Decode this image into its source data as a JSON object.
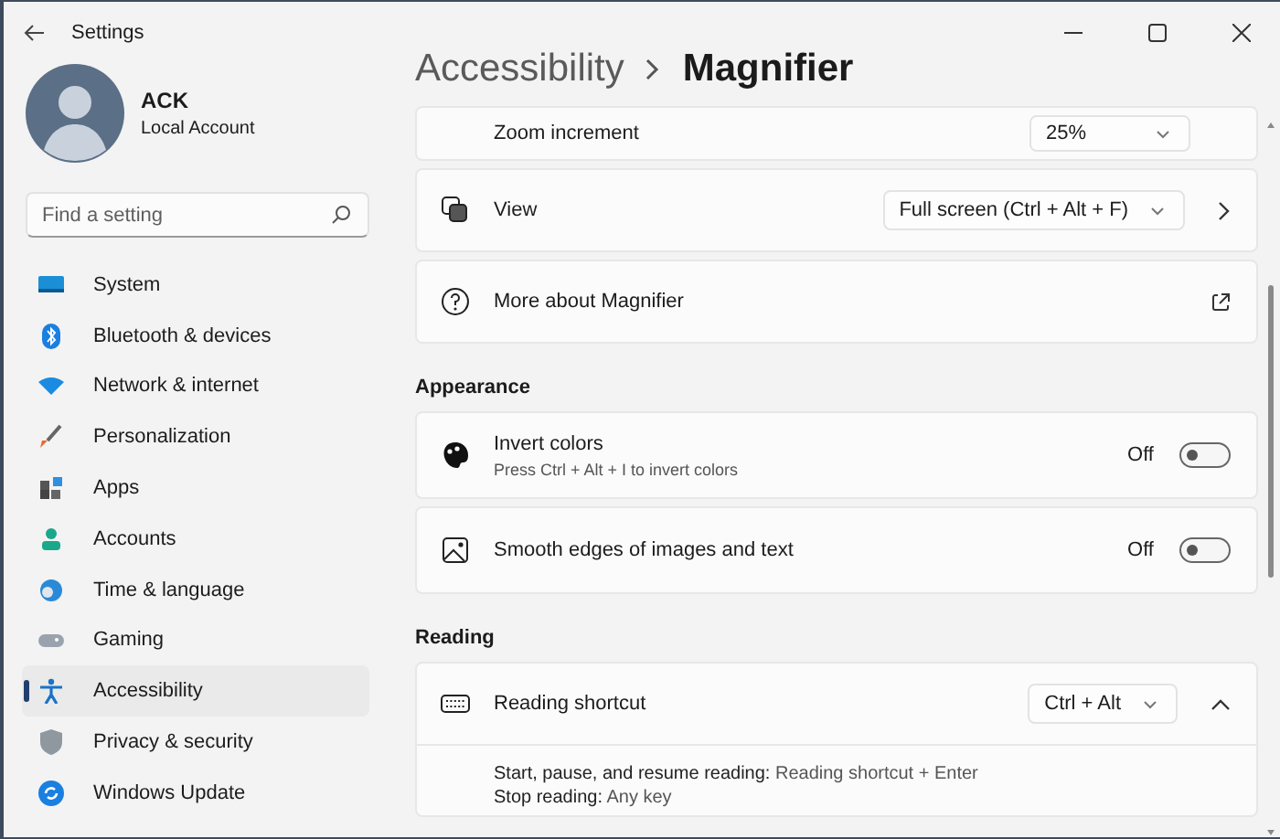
{
  "window": {
    "title": "Settings"
  },
  "account": {
    "name": "ACK",
    "type": "Local Account"
  },
  "search": {
    "placeholder": "Find a setting"
  },
  "nav": [
    {
      "label": "System",
      "selected": false
    },
    {
      "label": "Bluetooth & devices",
      "selected": false
    },
    {
      "label": "Network & internet",
      "selected": false
    },
    {
      "label": "Personalization",
      "selected": false
    },
    {
      "label": "Apps",
      "selected": false
    },
    {
      "label": "Accounts",
      "selected": false
    },
    {
      "label": "Time & language",
      "selected": false
    },
    {
      "label": "Gaming",
      "selected": false
    },
    {
      "label": "Accessibility",
      "selected": true
    },
    {
      "label": "Privacy & security",
      "selected": false
    },
    {
      "label": "Windows Update",
      "selected": false
    }
  ],
  "breadcrumb": {
    "parent": "Accessibility",
    "current": "Magnifier"
  },
  "sections": [
    {
      "rows": [
        {
          "kind": "dropdown",
          "label": "Zoom increment",
          "value": "25%"
        },
        {
          "kind": "dropdown-link",
          "label": "View",
          "value": "Full screen (Ctrl + Alt + F)"
        },
        {
          "kind": "link",
          "label": "More about Magnifier"
        }
      ]
    },
    {
      "heading": "Appearance",
      "rows": [
        {
          "kind": "toggle",
          "label": "Invert colors",
          "description": "Press Ctrl + Alt + I to invert colors",
          "state_label": "Off",
          "on": false
        },
        {
          "kind": "toggle",
          "label": "Smooth edges of images and text",
          "state_label": "Off",
          "on": false
        }
      ]
    },
    {
      "heading": "Reading",
      "rows": [
        {
          "kind": "expander",
          "label": "Reading shortcut",
          "value": "Ctrl + Alt",
          "expanded": true,
          "details": [
            "**Start, pause, and resume reading:** Reading shortcut + Enter",
            "**Stop reading:** Any key"
          ]
        }
      ]
    }
  ]
}
